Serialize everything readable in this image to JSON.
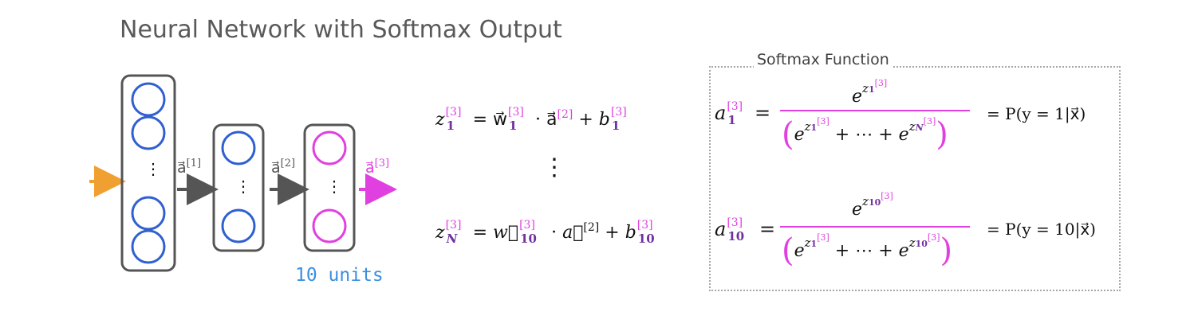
{
  "title": "Neural Network with Softmax Output",
  "network": {
    "arrow_label_1": "a⃗",
    "arrow_label_1_sup": "[1]",
    "arrow_label_2": "a⃗",
    "arrow_label_2_sup": "[2]",
    "output_label": "a⃗",
    "output_label_sup": "[3]",
    "dots": "⋮",
    "units_label": "10 units",
    "colors": {
      "input_arrow": "#f0a030",
      "hidden_units": "#3060d0",
      "output_units": "#e040e0",
      "layer_box": "#555555"
    }
  },
  "equations": {
    "row1": {
      "z": "z",
      "z_sup": "[3]",
      "z_sub": "1",
      "eq": "=",
      "w": "w⃗",
      "w_sup": "[3]",
      "w_sub": "1",
      "dot": "·",
      "a": "a⃗",
      "a_sup": "[2]",
      "plus": "+",
      "b": "b",
      "b_sup": "[3]",
      "b_sub": "1"
    },
    "vdots": "⋮",
    "row2": {
      "z": "z",
      "z_sup": "[3]",
      "z_sub": "N",
      "eq": "=",
      "w": "w⃗",
      "w_sup": "[3]",
      "w_sub": "10",
      "dot": "·",
      "a": "a⃗",
      "a_sup": "[2]",
      "plus": "+",
      "b": "b",
      "b_sup": "[3]",
      "b_sub": "10"
    }
  },
  "softmax": {
    "title": "Softmax Function",
    "row1": {
      "lhs": "a",
      "lhs_sup": "[3]",
      "lhs_sub": "1",
      "eq": "=",
      "num_e": "e",
      "num_z": "z",
      "num_sub": "1",
      "num_sup": "[3]",
      "den_left": "(",
      "den_e1": "e",
      "den_z1": "z",
      "den_sub1": "1",
      "den_sup1": "[3]",
      "den_mid": "+ ⋯ +",
      "den_e2": "e",
      "den_z2": "z",
      "den_sub2": "N",
      "den_sup2": "[3]",
      "den_right": ")",
      "rhs": "= P(y = 1|x⃗)"
    },
    "row2": {
      "lhs": "a",
      "lhs_sup": "[3]",
      "lhs_sub": "10",
      "eq": "=",
      "num_e": "e",
      "num_z": "z",
      "num_sub": "10",
      "num_sup": "[3]",
      "den_left": "(",
      "den_e1": "e",
      "den_z1": "z",
      "den_sub1": "1",
      "den_sup1": "[3]",
      "den_mid": "+ ⋯ +",
      "den_e2": "e",
      "den_z2": "z",
      "den_sub2": "10",
      "den_sup2": "[3]",
      "den_right": ")",
      "rhs": "= P(y = 10|x⃗)"
    }
  }
}
